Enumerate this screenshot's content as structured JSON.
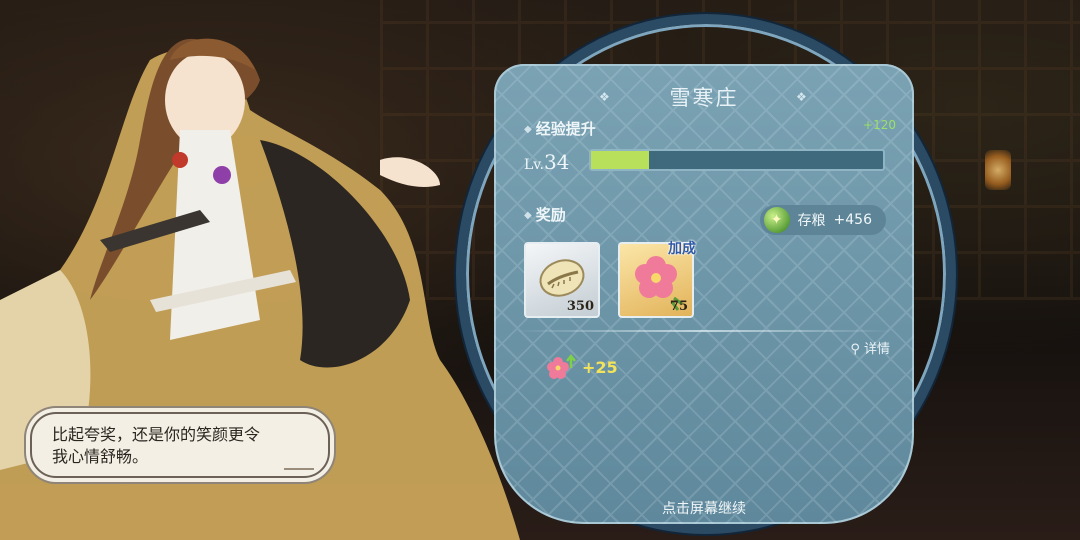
{
  "panel": {
    "title": "雪寒庄",
    "exp": {
      "label": "经验提升",
      "gain": "+120",
      "lv_prefix": "Lv.",
      "level": "34",
      "progress": 0.2
    },
    "rewards": {
      "label": "奖励",
      "bonus_tag": "加成",
      "items": [
        {
          "name": "shell",
          "qty": "350"
        },
        {
          "name": "flower",
          "qty": "75"
        }
      ]
    },
    "grain": {
      "label": "存粮",
      "value": "+456"
    },
    "detail": "详情",
    "extra_bonus": "+25",
    "continue_hint": "点击屏幕继续"
  },
  "dialog": {
    "line1": "比起夸奖，还是你的笑颜更令",
    "line2": "我心情舒畅。"
  },
  "colors": {
    "exp_fill": "#b9e05a",
    "bonus_value": "#f4e35a",
    "bonus_tag": "#2f5aa8"
  },
  "icons": [
    "grain-icon",
    "shell-icon",
    "flower-icon",
    "search-icon",
    "blossom-up-icon"
  ]
}
